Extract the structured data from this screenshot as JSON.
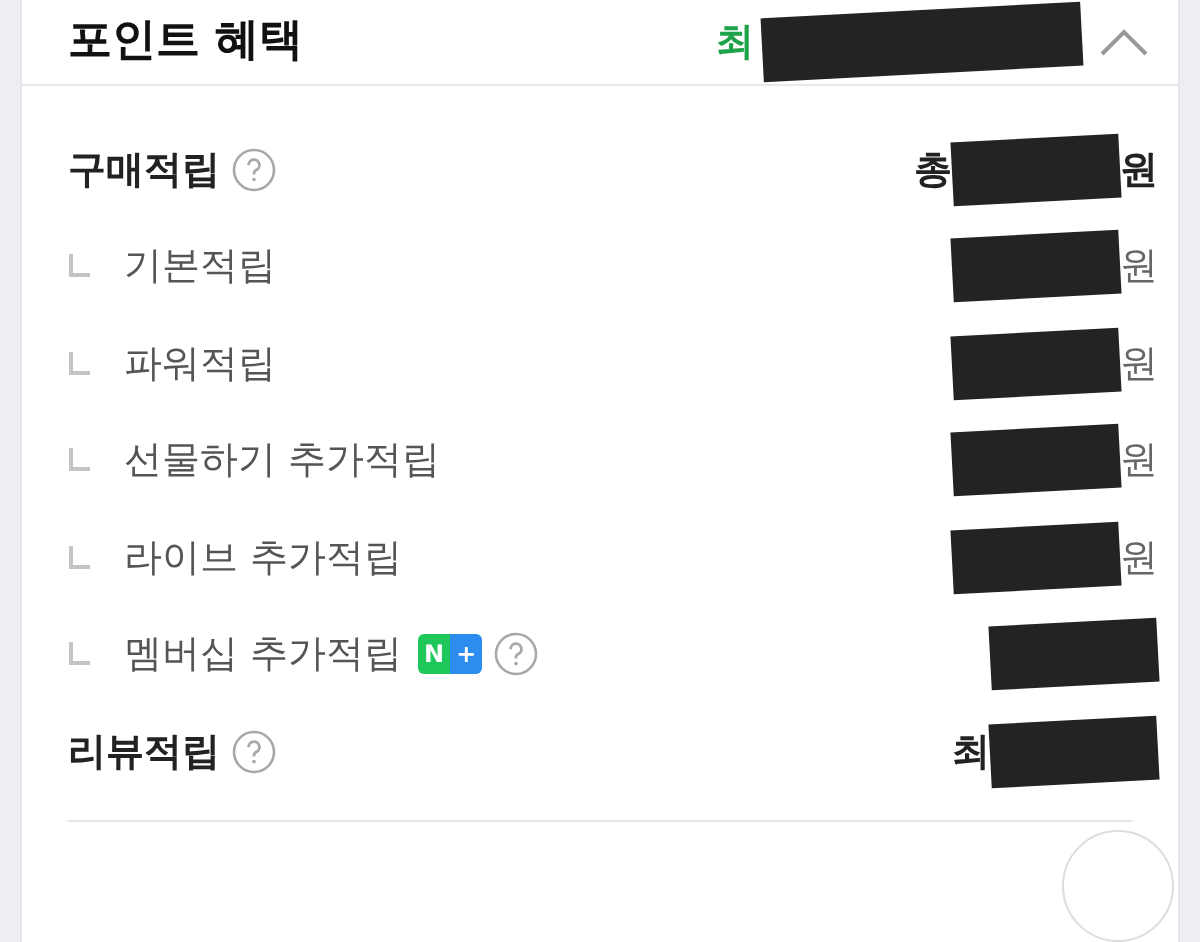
{
  "section": {
    "title": "포인트 혜택",
    "summary_start": "최",
    "redacted": true,
    "expanded": true
  },
  "rows": [
    {
      "kind": "main",
      "label": "구매적립",
      "help": true,
      "value_start": "총",
      "value_end": "원",
      "redacted": true
    },
    {
      "kind": "sub",
      "label": "기본적립",
      "value_end": "원",
      "redacted": true
    },
    {
      "kind": "sub",
      "label": "파워적립",
      "value_end": "원",
      "redacted": true
    },
    {
      "kind": "sub",
      "label": "선물하기 추가적립",
      "value_end": "원",
      "redacted": true
    },
    {
      "kind": "sub",
      "label": "라이브 추가적립",
      "value_end": "원",
      "redacted": true
    },
    {
      "kind": "sub",
      "label": "멤버십 추가적립",
      "badge": [
        "N",
        "+"
      ],
      "help": true,
      "redacted": true
    },
    {
      "kind": "main",
      "label": "리뷰적립",
      "help": true,
      "value_start": "최",
      "redacted": true
    }
  ]
}
